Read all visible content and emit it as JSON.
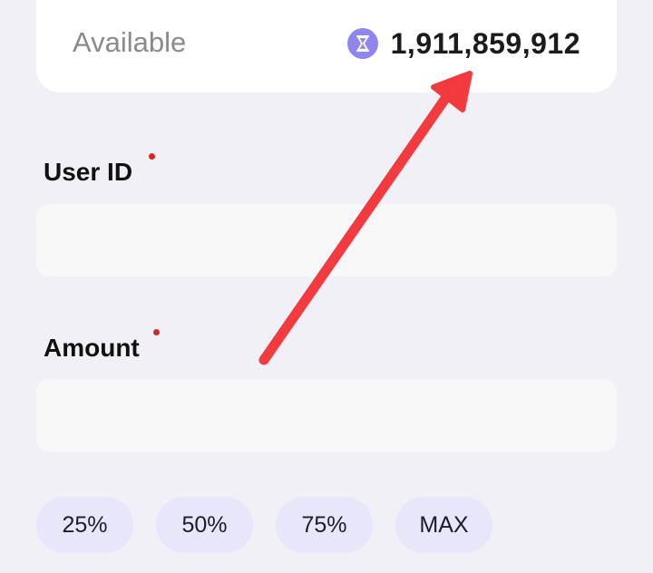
{
  "balance": {
    "label": "Available",
    "icon": "hourglass-icon",
    "value": "1,911,859,912",
    "coin_color": "#8f86f0"
  },
  "form": {
    "user_id": {
      "label": "User ID",
      "value": "",
      "placeholder": ""
    },
    "amount": {
      "label": "Amount",
      "value": "",
      "placeholder": ""
    },
    "required_dot_color": "#cc2a22"
  },
  "quick_amounts": [
    "25%",
    "50%",
    "75%",
    "MAX"
  ],
  "annotation": {
    "type": "red-arrow",
    "color": "#f23a3f"
  }
}
